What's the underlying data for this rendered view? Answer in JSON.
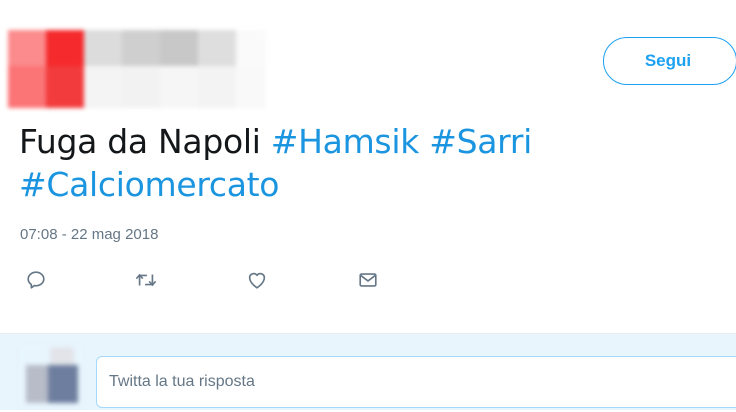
{
  "tweet": {
    "text": "Fuga da Napoli",
    "hashtags": [
      "#Hamsik",
      "#Sarri",
      "#Calciomercato"
    ],
    "timestamp": "07:08 - 22 mag 2018"
  },
  "header": {
    "follow_label": "Segui"
  },
  "actions": {
    "reply_icon": "comment-icon",
    "retweet_icon": "retweet-icon",
    "like_icon": "heart-icon",
    "dm_icon": "envelope-icon"
  },
  "reply": {
    "placeholder": "Twitta la tua risposta"
  },
  "colors": {
    "accent": "#1da1f2",
    "hashtag": "#1b95e0",
    "muted": "#657786"
  }
}
